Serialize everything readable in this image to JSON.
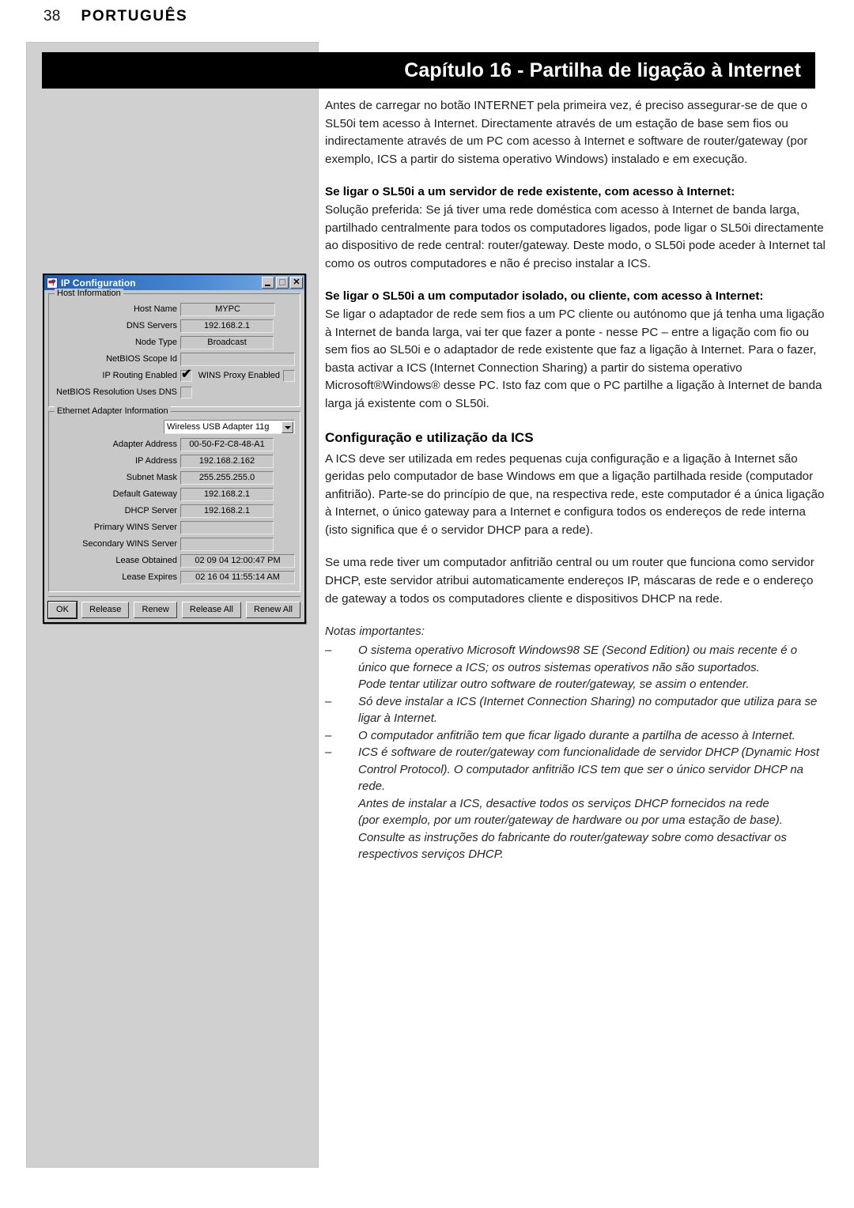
{
  "page": {
    "number": "38",
    "language": "PORTUGUÊS",
    "chapter_title": "Capítulo 16 - Partilha de ligação à Internet"
  },
  "content": {
    "intro_paragraph": "Antes de carregar no botão INTERNET pela primeira vez, é preciso assegurar-se de que o SL50i tem acesso à Internet. Directamente através de um estação de base sem fios ou indirectamente através de um PC com acesso à Internet e software de router/gateway (por exemplo, ICS a partir do sistema operativo Windows) instalado e em execução.",
    "section1_heading": "Se ligar o SL50i a um servidor de rede existente, com acesso à Internet:",
    "section1_body": "Solução preferida: Se já tiver uma rede doméstica com acesso à Internet de banda larga, partilhado centralmente para todos os computadores ligados, pode ligar o SL50i directamente ao dispositivo de rede central: router/gateway. Deste modo, o SL50i pode aceder à Internet tal como os outros computadores e não é preciso instalar a ICS.",
    "section2_heading": "Se ligar o SL50i a um computador isolado, ou cliente, com acesso à Internet:",
    "section2_body": "Se ligar o adaptador de rede sem fios a um PC cliente ou autónomo que já tenha uma ligação à Internet de banda larga, vai ter que fazer a ponte - nesse PC – entre a ligação com fio ou sem fios ao SL50i e o adaptador de rede existente que faz a ligação à Internet. Para o fazer, basta activar a ICS (Internet Connection Sharing) a partir do sistema operativo Microsoft®Windows® desse PC. Isto faz com que o PC partilhe a ligação à Internet de banda larga já existente com o SL50i.",
    "ics_heading": "Configuração e utilização da ICS",
    "ics_paragraph1": "A ICS deve ser utilizada em redes pequenas cuja configuração e a ligação à Internet são geridas pelo computador de base Windows em que a ligação partilhada reside (computador anfitrião). Parte-se do princípio de que, na respectiva rede, este computador é a única ligação à Internet, o único gateway para a Internet e configura todos os endereços de rede interna (isto significa que é o servidor DHCP para a rede).",
    "ics_paragraph2": "Se uma rede tiver um computador anfitrião central ou um router que funciona como servidor DHCP, este servidor atribui automaticamente endereços IP, máscaras de rede e o endereço de gateway a todos os computadores cliente e dispositivos DHCP na rede.",
    "notes_title": "Notas importantes:",
    "notes_dash": "–",
    "notes": [
      {
        "main": "O sistema operativo Microsoft Windows98 SE (Second Edition) ou mais recente é o único que fornece a ICS; os outros sistemas operativos não são suportados.",
        "sub": [
          "Pode tentar utilizar outro software de router/gateway, se assim o entender."
        ]
      },
      {
        "main": "Só deve instalar a ICS (Internet Connection Sharing) no computador que utiliza para se ligar à Internet.",
        "sub": []
      },
      {
        "main": "O computador anfitrião tem que ficar ligado durante a partilha de acesso à Internet.",
        "sub": []
      },
      {
        "main": "ICS é software de router/gateway com funcionalidade de servidor DHCP (Dynamic Host Control Protocol). O computador anfitrião ICS tem que ser o único servidor DHCP na rede.",
        "sub": [
          "Antes de instalar a ICS, desactive todos os serviços DHCP fornecidos na rede",
          "(por exemplo, por um router/gateway de hardware ou por uma estação de base).",
          "Consulte as instruções do fabricante do router/gateway sobre como desactivar os respectivos serviços DHCP."
        ]
      }
    ]
  },
  "dialog": {
    "title": "IP Configuration",
    "window_buttons": {
      "minimize": "_",
      "maximize": "",
      "close": "✕"
    },
    "host_group": {
      "legend": "Host Information",
      "fields": [
        {
          "label": "Host Name",
          "value": "MYPC"
        },
        {
          "label": "DNS Servers",
          "value": "192.168.2.1"
        },
        {
          "label": "Node Type",
          "value": "Broadcast"
        },
        {
          "label": "NetBIOS Scope Id",
          "value": ""
        }
      ],
      "ip_routing_label": "IP Routing Enabled",
      "ip_routing_checked": true,
      "wins_proxy_label": "WINS Proxy Enabled",
      "wins_proxy_checked": false,
      "netbios_dns_label": "NetBIOS Resolution Uses DNS",
      "netbios_dns_checked": false
    },
    "adapter_group": {
      "legend": "Ethernet  Adapter Information",
      "selected_adapter": "Wireless USB Adapter 11g",
      "fields": [
        {
          "label": "Adapter Address",
          "value": "00-50-F2-C8-48-A1"
        },
        {
          "label": "IP Address",
          "value": "192.168.2.162"
        },
        {
          "label": "Subnet Mask",
          "value": "255.255.255.0"
        },
        {
          "label": "Default Gateway",
          "value": "192.168.2.1"
        },
        {
          "label": "DHCP Server",
          "value": "192.168.2.1"
        },
        {
          "label": "Primary WINS Server",
          "value": ""
        },
        {
          "label": "Secondary WINS Server",
          "value": ""
        },
        {
          "label": "Lease Obtained",
          "value": "02 09 04 12:00:47 PM"
        },
        {
          "label": "Lease Expires",
          "value": "02 16 04 11:55:14 AM"
        }
      ]
    },
    "buttons": [
      {
        "label": "OK",
        "accel_before": "OK",
        "accel": "",
        "accel_after": ""
      },
      {
        "label": "Release",
        "accel_before": "Relea",
        "accel": "s",
        "accel_after": "e"
      },
      {
        "label": "Renew",
        "accel_before": "Re",
        "accel": "n",
        "accel_after": "ew"
      },
      {
        "label": "Release All",
        "accel_before": "Relea",
        "accel": "s",
        "accel_after": "e All"
      },
      {
        "label": "Renew All",
        "accel_before": "Rene",
        "accel": "w",
        "accel_after": " All"
      }
    ]
  },
  "colors": {
    "panel_gray": "#d0d0d0",
    "title_bar_black": "#000000",
    "dialog_face": "#c8c8c8",
    "dialog_titlebar_blue": "#2060b0"
  }
}
